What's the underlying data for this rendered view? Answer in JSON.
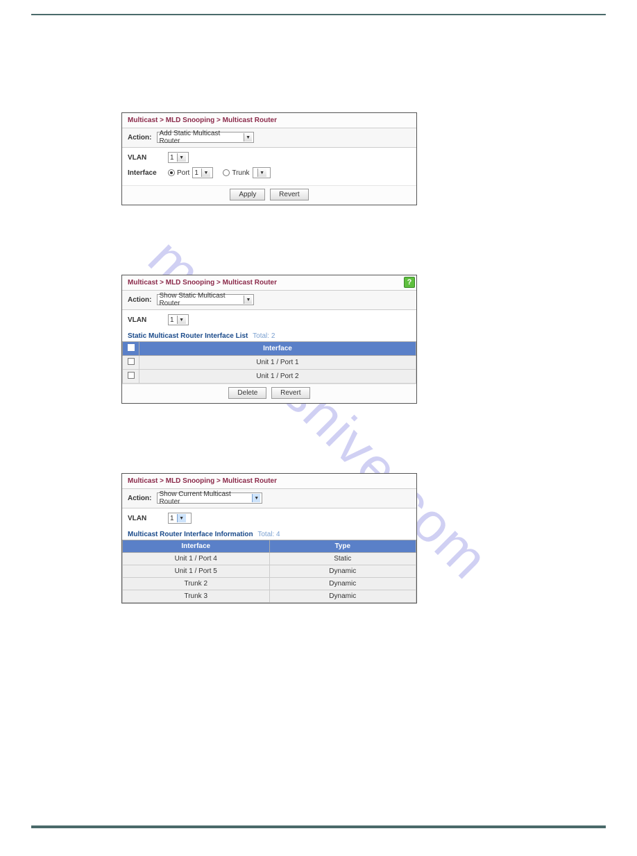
{
  "watermark": "manualshive.com",
  "panel1": {
    "breadcrumb": "Multicast > MLD Snooping > Multicast Router",
    "action_label": "Action:",
    "action_value": "Add Static Multicast Router",
    "vlan_label": "VLAN",
    "vlan_value": "1",
    "interface_label": "Interface",
    "port_label": "Port",
    "port_value": "1",
    "trunk_label": "Trunk",
    "apply_btn": "Apply",
    "revert_btn": "Revert"
  },
  "panel2": {
    "breadcrumb": "Multicast > MLD Snooping > Multicast Router",
    "action_label": "Action:",
    "action_value": "Show Static Multicast Router",
    "vlan_label": "VLAN",
    "vlan_value": "1",
    "list_title": "Static Multicast Router Interface List",
    "total_label": "Total: 2",
    "col_interface": "Interface",
    "rows": [
      {
        "interface": "Unit 1 / Port 1"
      },
      {
        "interface": "Unit 1 / Port 2"
      }
    ],
    "delete_btn": "Delete",
    "revert_btn": "Revert",
    "help": "?"
  },
  "panel3": {
    "breadcrumb": "Multicast > MLD Snooping > Multicast Router",
    "action_label": "Action:",
    "action_value": "Show Current Multicast Router",
    "vlan_label": "VLAN",
    "vlan_value": "1",
    "list_title": "Multicast Router Interface Information",
    "total_label": "Total: 4",
    "col_interface": "Interface",
    "col_type": "Type",
    "rows": [
      {
        "interface": "Unit 1 / Port 4",
        "type": "Static"
      },
      {
        "interface": "Unit 1 / Port 5",
        "type": "Dynamic"
      },
      {
        "interface": "Trunk 2",
        "type": "Dynamic"
      },
      {
        "interface": "Trunk 3",
        "type": "Dynamic"
      }
    ]
  }
}
